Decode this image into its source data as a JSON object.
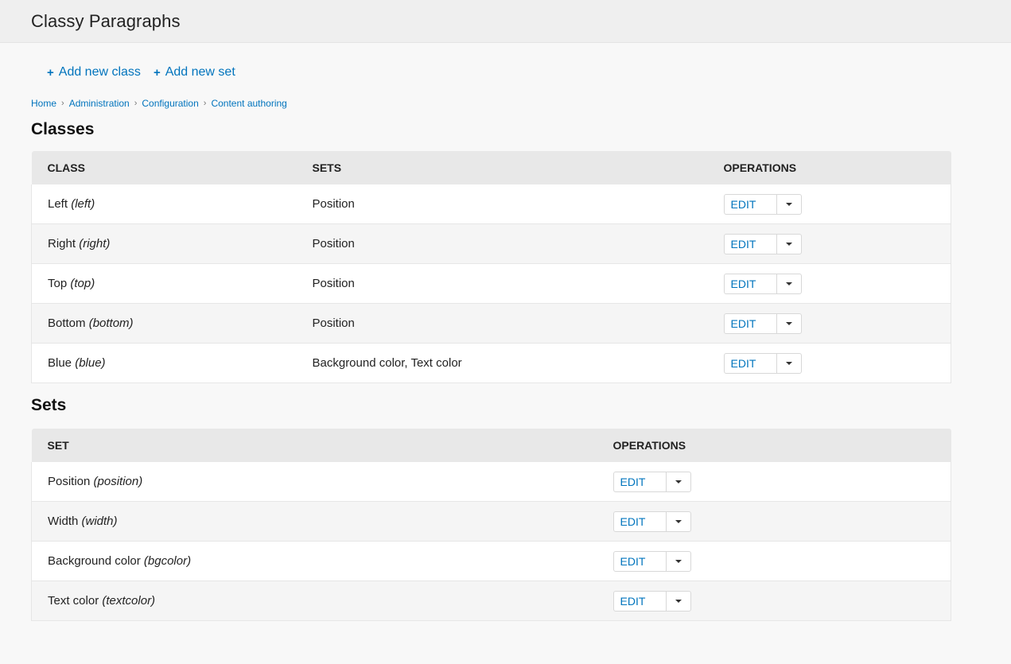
{
  "page": {
    "title": "Classy Paragraphs"
  },
  "actions": [
    {
      "label": "Add new class",
      "icon": "plus-icon"
    },
    {
      "label": "Add new set",
      "icon": "plus-icon"
    }
  ],
  "breadcrumb": [
    "Home",
    "Administration",
    "Configuration",
    "Content authoring"
  ],
  "classes": {
    "title": "Classes",
    "headers": [
      "Class",
      "Sets",
      "Operations"
    ],
    "rows": [
      {
        "name": "Left",
        "machine": "(left)",
        "sets": "Position",
        "op": "Edit"
      },
      {
        "name": "Right",
        "machine": "(right)",
        "sets": "Position",
        "op": "Edit"
      },
      {
        "name": "Top",
        "machine": "(top)",
        "sets": "Position",
        "op": "Edit"
      },
      {
        "name": "Bottom",
        "machine": "(bottom)",
        "sets": "Position",
        "op": "Edit"
      },
      {
        "name": "Blue",
        "machine": "(blue)",
        "sets": "Background color, Text color",
        "op": "Edit"
      }
    ]
  },
  "sets": {
    "title": "Sets",
    "headers": [
      "Set",
      "Operations"
    ],
    "rows": [
      {
        "name": "Position",
        "machine": "(position)",
        "op": "Edit"
      },
      {
        "name": "Width",
        "machine": "(width)",
        "op": "Edit"
      },
      {
        "name": "Background color",
        "machine": "(bgcolor)",
        "op": "Edit"
      },
      {
        "name": "Text color",
        "machine": "(textcolor)",
        "op": "Edit"
      }
    ]
  },
  "colors": {
    "link": "#0074bd",
    "header_bg": "#efefef",
    "table_head_bg": "#e8e8e8"
  }
}
